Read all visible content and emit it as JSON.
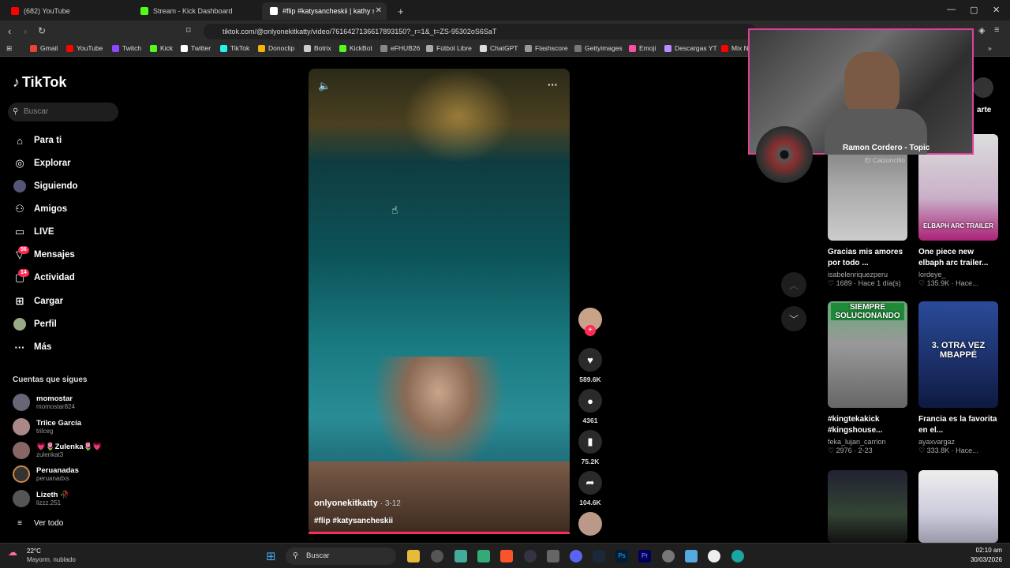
{
  "browser": {
    "tabs": [
      {
        "label": "(682) YouTube",
        "color": "#ff0000"
      },
      {
        "label": "Stream - Kick Dashboard",
        "color": "#53fc18"
      },
      {
        "label": "#flip #katysancheskii | kathy sanc",
        "color": "#ffffff"
      }
    ],
    "new_tab": "+",
    "url": "tiktok.com/@onlyonekitkatty/video/7616427136617893150?_r=1&_t=ZS-95302oS6SaT",
    "bookmarks": [
      "Gmail",
      "YouTube",
      "Twitch",
      "Kick",
      "Twitter",
      "TikTok",
      "Donoclip",
      "Botrix",
      "KickBot",
      "eFHUB26",
      "Fútbol Libre",
      "ChatGPT",
      "Flashscore",
      "Gettyimages",
      "Emoji",
      "Descargas YT",
      "Mix N"
    ]
  },
  "sidebar": {
    "logo": "TikTok",
    "search_placeholder": "Buscar",
    "nav": [
      {
        "label": "Para ti",
        "icon": "home-icon"
      },
      {
        "label": "Explorar",
        "icon": "compass-icon"
      },
      {
        "label": "Siguiendo",
        "icon": "following-icon"
      },
      {
        "label": "Amigos",
        "icon": "friends-icon"
      },
      {
        "label": "LIVE",
        "icon": "live-icon"
      },
      {
        "label": "Mensajes",
        "icon": "messages-icon",
        "badge": "56"
      },
      {
        "label": "Actividad",
        "icon": "activity-icon",
        "badge": "14"
      },
      {
        "label": "Cargar",
        "icon": "upload-icon"
      },
      {
        "label": "Perfil",
        "icon": "profile-icon"
      },
      {
        "label": "Más",
        "icon": "more-icon"
      }
    ],
    "following_title": "Cuentas que sigues",
    "accounts": [
      {
        "name": "momostar",
        "handle": "momostar824"
      },
      {
        "name": "Trilce García",
        "handle": "trilceg"
      },
      {
        "name": "💗🌷Zulenka🌷💗",
        "handle": "zulenkat3"
      },
      {
        "name": "Peruanadas",
        "handle": "peruanadxs"
      },
      {
        "name": "Lizeth 🥀",
        "handle": "lizzz.251"
      }
    ],
    "see_all": "Ver todo"
  },
  "video": {
    "author": "onlyonekitkatty",
    "date": "· 3-12",
    "caption": "#flip #katysancheskii",
    "likes": "589.6K",
    "comments": "4361",
    "saves": "75.2K",
    "shares": "104.6K"
  },
  "overlay": {
    "song": "Ramon Cordero - Topic",
    "artist": "El Calzoncillo",
    "partial_header": "arte"
  },
  "recommended": [
    {
      "title": "Gracias mis amores por todo ...",
      "user": "isabelenriquezperu",
      "meta": "♡ 1689 · Hace 1 día(s)",
      "thumb_text": ""
    },
    {
      "title": "One piece new elbaph arc trailer...",
      "user": "lordeye_",
      "meta": "♡ 135.9K · Hace...",
      "thumb_text": "ELBAPH ARC TRAILER"
    },
    {
      "title": "#kingtekakick #kingshouse...",
      "user": "feka_lujan_carrion",
      "meta": "♡ 2976 · 2-23",
      "thumb_text": "SIEMPRE SOLUCIONANDO"
    },
    {
      "title": "Francia es la favorita en el...",
      "user": "ayaxvargaz",
      "meta": "♡ 333.8K · Hace...",
      "thumb_text": "3. OTRA VEZ MBAPPÉ"
    }
  ],
  "taskbar": {
    "weather_temp": "22°C",
    "weather_desc": "Mayorm. nublado",
    "search": "Buscar",
    "time": "02:10 am",
    "date": "30/03/2026"
  },
  "colors": {
    "accent": "#fe2c55",
    "webcam_border": "#e0409a"
  }
}
